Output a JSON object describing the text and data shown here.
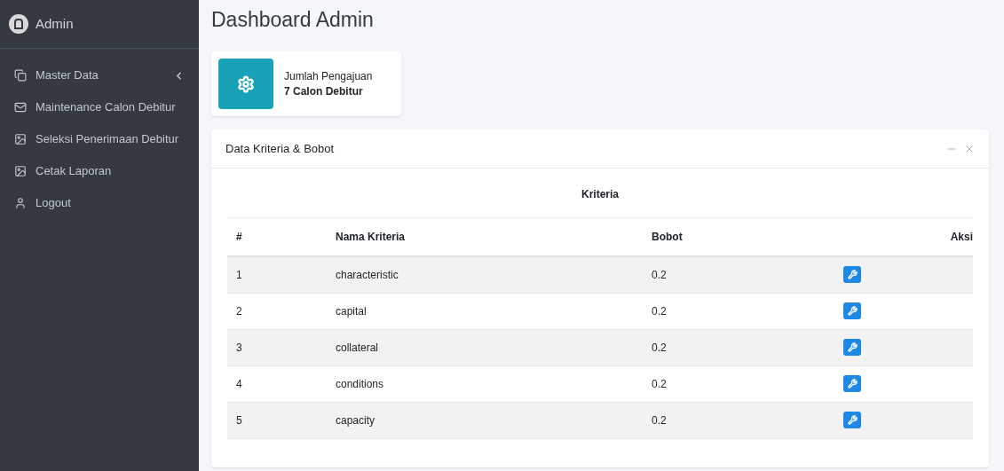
{
  "sidebar": {
    "brand": "Admin",
    "items": [
      {
        "label": "Master Data",
        "expanded": false
      },
      {
        "label": "Maintenance Calon Debitur"
      },
      {
        "label": "Seleksi Penerimaan Debitur"
      },
      {
        "label": "Cetak Laporan"
      },
      {
        "label": "Logout"
      }
    ]
  },
  "page_title": "Dashboard Admin",
  "info_box": {
    "label": "Jumlah Pengajuan",
    "value": "7 Calon Debitur"
  },
  "card": {
    "title": "Data Kriteria & Bobot",
    "table": {
      "caption": "Kriteria",
      "columns": [
        "#",
        "Nama Kriteria",
        "Bobot",
        "Aksi"
      ],
      "rows": [
        {
          "no": "1",
          "name": "characteristic",
          "weight": "0.2"
        },
        {
          "no": "2",
          "name": "capital",
          "weight": "0.2"
        },
        {
          "no": "3",
          "name": "collateral",
          "weight": "0.2"
        },
        {
          "no": "4",
          "name": "conditions",
          "weight": "0.2"
        },
        {
          "no": "5",
          "name": "capacity",
          "weight": "0.2"
        }
      ]
    }
  }
}
